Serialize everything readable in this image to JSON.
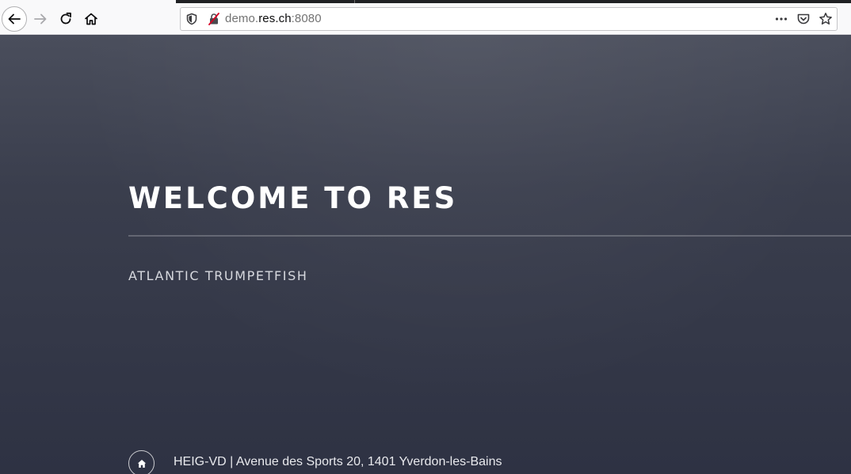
{
  "browser": {
    "url": {
      "prefix": "demo.",
      "host": "res.ch",
      "port": ":8080"
    },
    "icons": {
      "back": "back-arrow-icon",
      "forward": "forward-arrow-icon",
      "reload": "reload-icon",
      "home": "home-icon",
      "tracking": "shield-icon",
      "insecure": "insecure-lock-icon",
      "page_actions": "ellipsis-icon",
      "pocket": "pocket-icon",
      "bookmark": "star-icon"
    }
  },
  "page": {
    "title": "WELCOME TO RES",
    "subtitle": "ATLANTIC TRUMPETFISH",
    "footer": {
      "icon": "home-icon",
      "address": "HEIG-VD | Avenue des Sports 20, 1401 Yverdon-les-Bains"
    },
    "colors": {
      "background_top": "#4a4e5c",
      "background_bottom": "#2e3243",
      "title": "#ffffff",
      "subtitle": "#d6d8de"
    }
  }
}
